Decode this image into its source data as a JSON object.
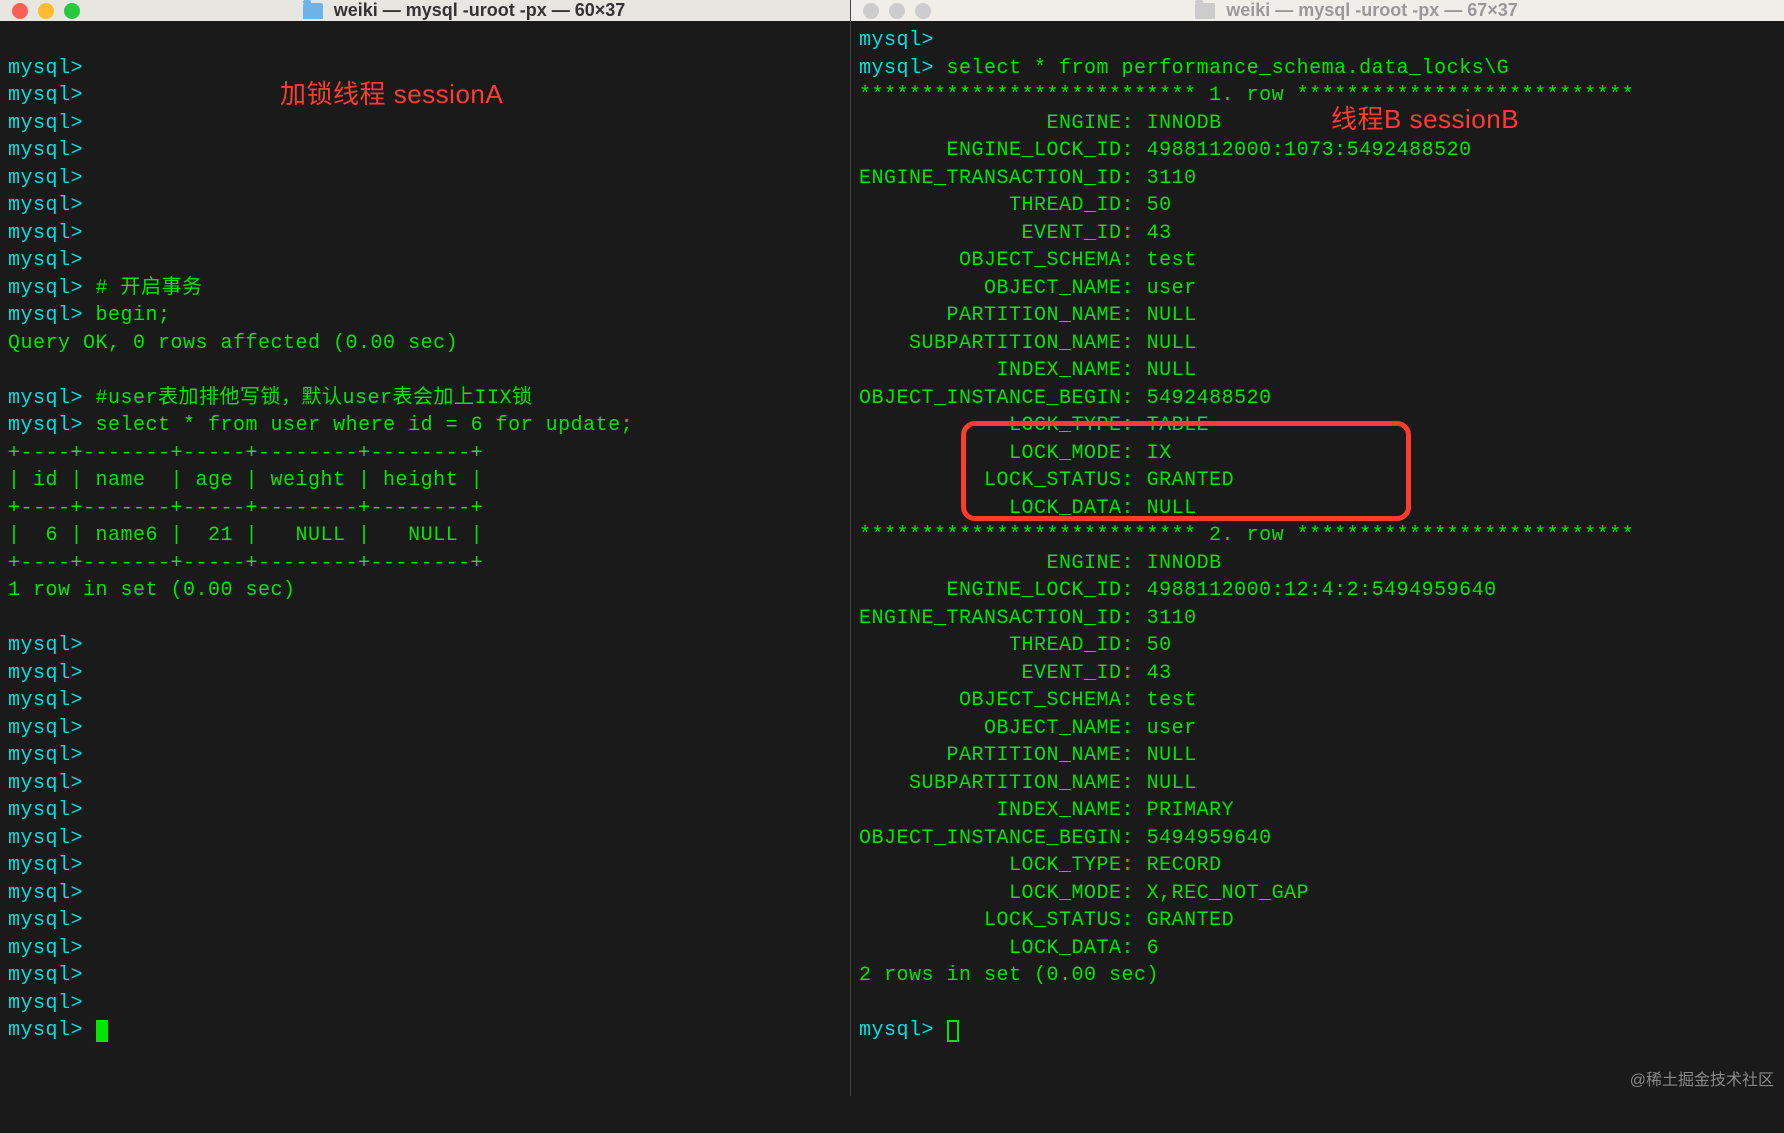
{
  "left": {
    "title": "weiki — mysql -uroot -px — 60×37",
    "annotation": "加锁线程 sessionA",
    "prompt": "mysql>",
    "lines": {
      "comment1": "# 开启事务",
      "begin": "begin;",
      "query_ok": "Query OK, 0 rows affected (0.00 sec)",
      "comment2": "#user表加排他写锁，默认user表会加上IIX锁",
      "select": "select * from user where id = 6 for update;",
      "sep": "+----+-------+-----+--------+--------+",
      "header": "| id | name  | age | weight | height |",
      "row": "|  6 | name6 |  21 |   NULL |   NULL |",
      "result": "1 row in set (0.00 sec)"
    }
  },
  "right": {
    "title": "weiki — mysql -uroot -px — 67×37",
    "annotation": "线程B sessionB",
    "prompt": "mysql>",
    "select": "select * from performance_schema.data_locks\\G",
    "row1_header": "*************************** 1. row ***************************",
    "row2_header": "*************************** 2. row ***************************",
    "rows_result": "2 rows in set (0.00 sec)",
    "row1": {
      "ENGINE": "INNODB",
      "ENGINE_LOCK_ID": "4988112000:1073:5492488520",
      "ENGINE_TRANSACTION_ID": "3110",
      "THREAD_ID": "50",
      "EVENT_ID": "43",
      "OBJECT_SCHEMA": "test",
      "OBJECT_NAME": "user",
      "PARTITION_NAME": "NULL",
      "SUBPARTITION_NAME": "NULL",
      "INDEX_NAME": "NULL",
      "OBJECT_INSTANCE_BEGIN": "5492488520",
      "LOCK_TYPE": "TABLE",
      "LOCK_MODE": "IX",
      "LOCK_STATUS": "GRANTED",
      "LOCK_DATA": "NULL"
    },
    "row2": {
      "ENGINE": "INNODB",
      "ENGINE_LOCK_ID": "4988112000:12:4:2:5494959640",
      "ENGINE_TRANSACTION_ID": "3110",
      "THREAD_ID": "50",
      "EVENT_ID": "43",
      "OBJECT_SCHEMA": "test",
      "OBJECT_NAME": "user",
      "PARTITION_NAME": "NULL",
      "SUBPARTITION_NAME": "NULL",
      "INDEX_NAME": "PRIMARY",
      "OBJECT_INSTANCE_BEGIN": "5494959640",
      "LOCK_TYPE": "RECORD",
      "LOCK_MODE": "X,REC_NOT_GAP",
      "LOCK_STATUS": "GRANTED",
      "LOCK_DATA": "6"
    }
  },
  "watermark": "@稀土掘金技术社区",
  "label_width": 21
}
